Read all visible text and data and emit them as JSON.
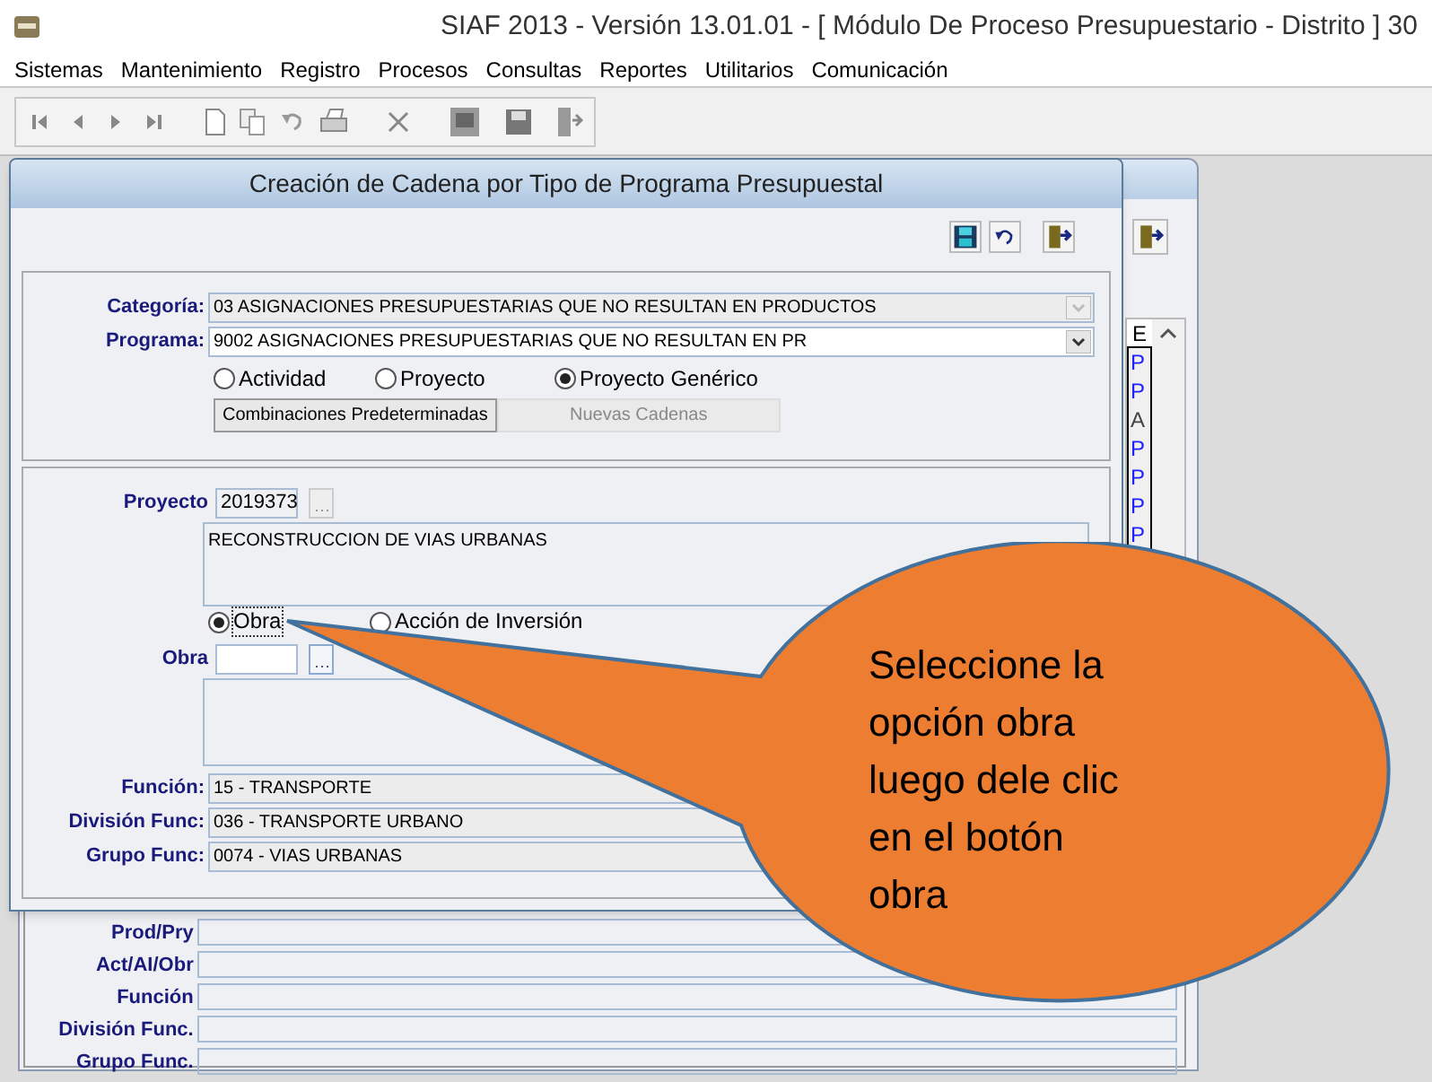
{
  "window": {
    "title": "SIAF 2013 - Versión 13.01.01 - [ Módulo De Proceso Presupuestario - Distrito ] 30"
  },
  "menu": [
    "Sistemas",
    "Mantenimiento",
    "Registro",
    "Procesos",
    "Consultas",
    "Reportes",
    "Utilitarios",
    "Comunicación"
  ],
  "back_window": {
    "column_header": "E",
    "column_values": [
      {
        "text": "P",
        "kind": "project"
      },
      {
        "text": "P",
        "kind": "project"
      },
      {
        "text": "A",
        "kind": "activity"
      },
      {
        "text": "P",
        "kind": "project"
      },
      {
        "text": "P",
        "kind": "project"
      },
      {
        "text": "P",
        "kind": "project"
      },
      {
        "text": "P",
        "kind": "project"
      }
    ],
    "fields": [
      {
        "label": "Prod/Pry"
      },
      {
        "label": "Act/AI/Obr"
      },
      {
        "label": "Función"
      },
      {
        "label": "División Func."
      },
      {
        "label": "Grupo Func."
      }
    ]
  },
  "dialog": {
    "title": "Creación de Cadena por Tipo de Programa Presupuestal",
    "categoria": {
      "label": "Categoría:",
      "value": "03 ASIGNACIONES PRESUPUESTARIAS QUE NO RESULTAN EN PRODUCTOS",
      "disabled": true
    },
    "programa": {
      "label": "Programa:",
      "value": "9002 ASIGNACIONES PRESUPUESTARIAS QUE NO RESULTAN EN PR",
      "disabled": false
    },
    "tipo_options": [
      {
        "label": "Actividad",
        "selected": false
      },
      {
        "label": "Proyecto",
        "selected": false
      },
      {
        "label": "Proyecto Genérico",
        "selected": true
      }
    ],
    "buttons": [
      {
        "label": "Combinaciones Predeterminadas",
        "disabled": false
      },
      {
        "label": "Nuevas Cadenas",
        "disabled": true
      }
    ],
    "proyecto": {
      "label": "Proyecto",
      "code": "2019373",
      "description": "RECONSTRUCCION DE VIAS URBANAS"
    },
    "obra_options": [
      {
        "label": "Obra",
        "selected": true
      },
      {
        "label": "Acción de Inversión",
        "selected": false
      }
    ],
    "obra": {
      "label": "Obra"
    },
    "clasificacion": [
      {
        "label": "Función:",
        "value": "15 - TRANSPORTE"
      },
      {
        "label": "División Func:",
        "value": "036 - TRANSPORTE URBANO"
      },
      {
        "label": "Grupo Func:",
        "value": "0074 - VIAS URBANAS"
      }
    ]
  },
  "callout": {
    "lines": [
      "Seleccione la",
      "opción obra",
      "luego dele clic",
      "en el botón",
      "obra"
    ]
  }
}
